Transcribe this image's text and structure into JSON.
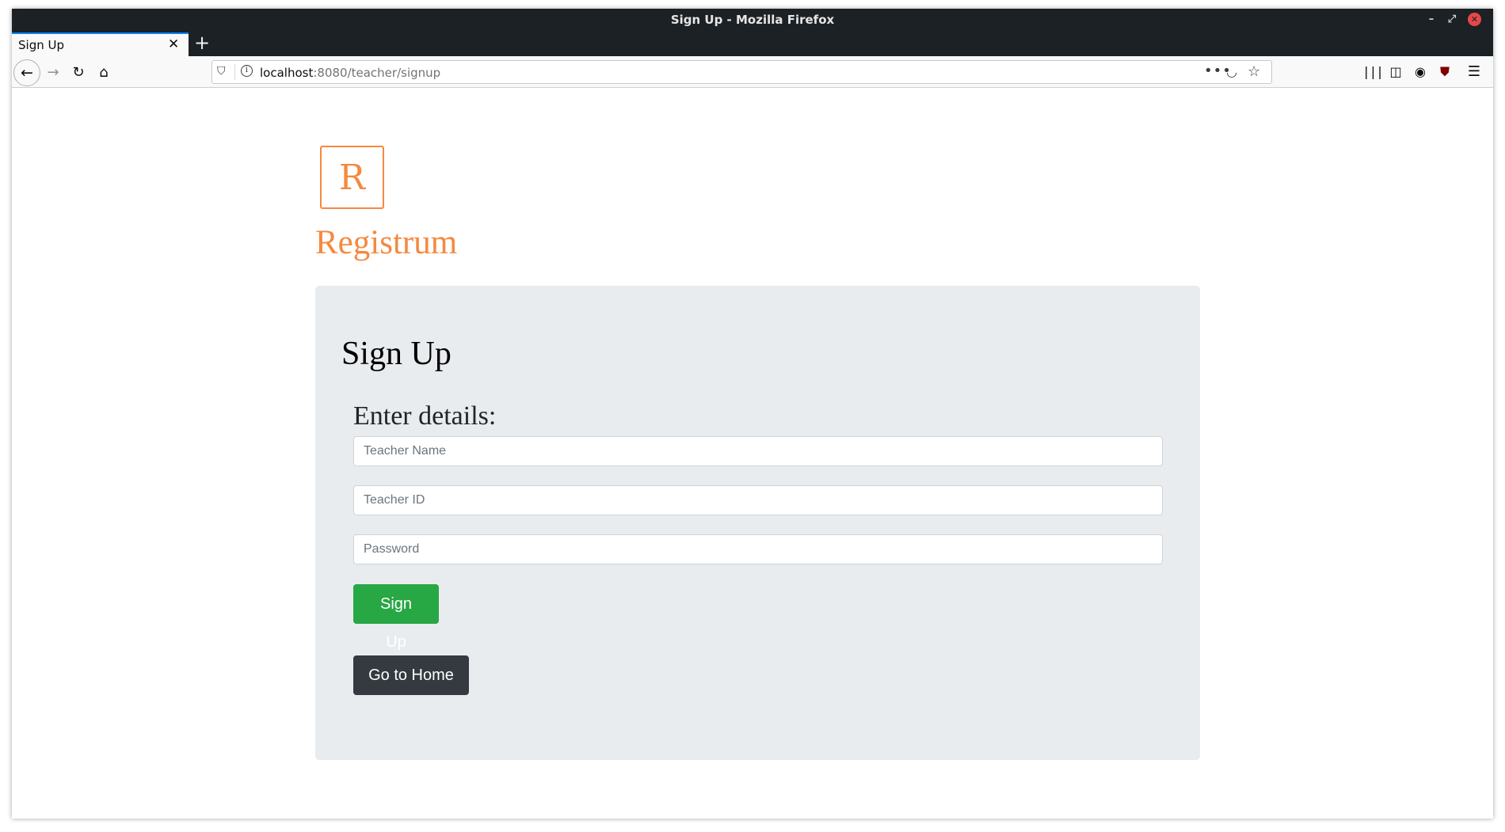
{
  "window": {
    "title": "Sign Up - Mozilla Firefox"
  },
  "tabs": [
    {
      "label": "Sign Up",
      "active": true
    }
  ],
  "toolbar": {
    "url_host": "localhost",
    "url_rest": ":8080/teacher/signup",
    "icons": [
      "back-icon",
      "forward-icon",
      "reload-icon",
      "home-icon",
      "shield-icon",
      "info-icon",
      "more-icon",
      "pocket-icon",
      "bookmark-star-icon",
      "library-icon",
      "sidebar-icon",
      "account-icon",
      "ublock-icon",
      "menu-icon"
    ]
  },
  "page": {
    "logo_letter": "R",
    "brand": "Registrum",
    "card": {
      "title": "Sign Up",
      "legend": "Enter details:",
      "fields": {
        "name_placeholder": "Teacher Name",
        "id_placeholder": "Teacher ID",
        "password_placeholder": "Password"
      },
      "signup_label": "Sign Up",
      "home_label": "Go to Home"
    }
  },
  "colors": {
    "brand": "#f5893f",
    "card_bg": "#e9ecef",
    "success": "#28a745",
    "dark": "#343a40",
    "chrome_dark": "#1c2125",
    "tab_accent": "#0a84ff"
  }
}
